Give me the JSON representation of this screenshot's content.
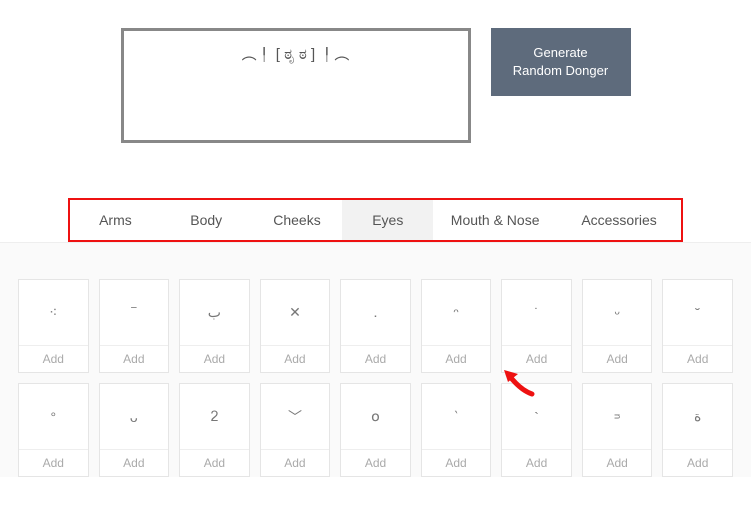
{
  "preview": "︵╿ [ ಠೃ ಠ ]  ╿︵",
  "generate_label": "Generate\nRandom Donger",
  "tabs": [
    {
      "label": "Arms",
      "active": false
    },
    {
      "label": "Body",
      "active": false
    },
    {
      "label": "Cheeks",
      "active": false
    },
    {
      "label": "Eyes",
      "active": true
    },
    {
      "label": "Mouth & Nose",
      "active": false
    },
    {
      "label": "Accessories",
      "active": false
    }
  ],
  "add_label": "Add",
  "items": [
    "⁖",
    "‾",
    "ب",
    "✕",
    "․",
    "ᵔ",
    "˙",
    "ᵕ",
    "˘",
    "°",
    "ᴗ",
    "ᒿ",
    "﹀",
    "໐",
    "‵",
    "`",
    "ᵙ",
    "ة"
  ]
}
